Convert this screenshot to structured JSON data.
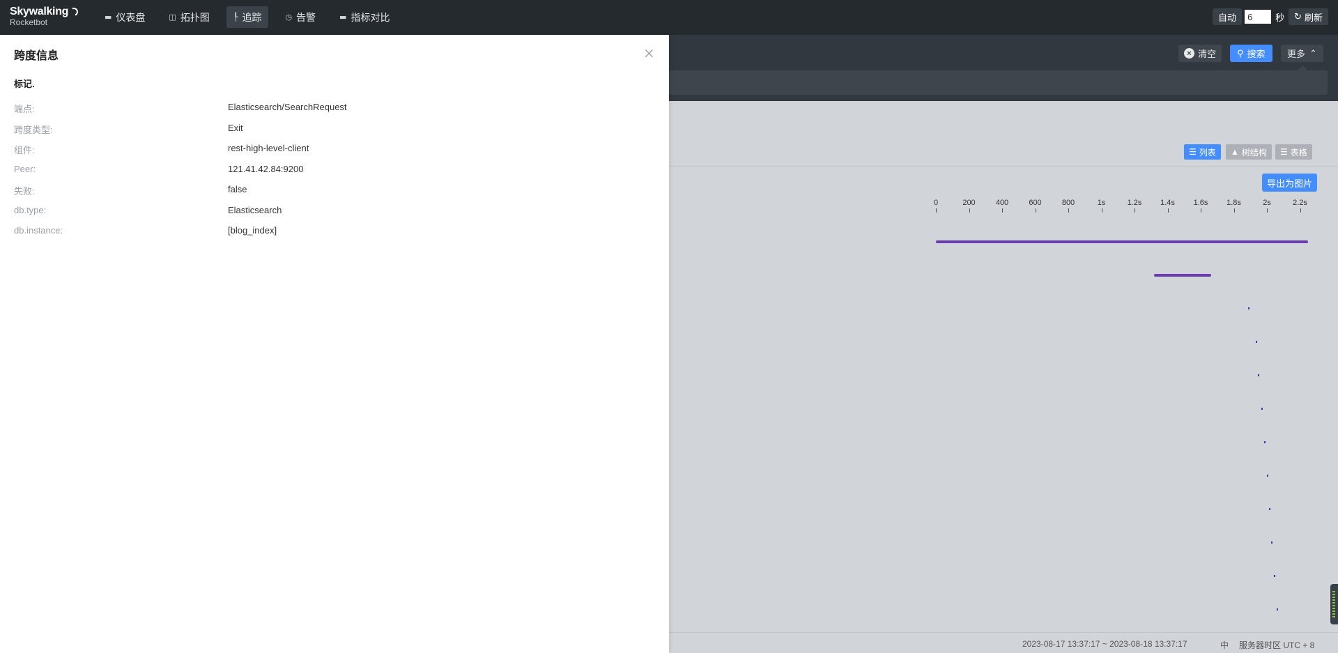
{
  "app": {
    "brand": "Skywalking",
    "subtitle": "Rocketbot"
  },
  "nav": {
    "items": [
      {
        "label": "仪表盘",
        "icon": "chart-icon"
      },
      {
        "label": "拓扑图",
        "icon": "topology-icon"
      },
      {
        "label": "追踪",
        "icon": "trace-icon",
        "active": true
      },
      {
        "label": "告警",
        "icon": "alarm-icon"
      },
      {
        "label": "指标对比",
        "icon": "compare-icon"
      }
    ]
  },
  "topright": {
    "auto_label": "自动",
    "interval_value": "6",
    "interval_unit": "秒",
    "refresh_label": "刷新"
  },
  "search": {
    "clear_label": "清空",
    "search_label": "搜索",
    "more_label": "更多"
  },
  "trace": {
    "view_list": "列表",
    "view_tree": "树结构",
    "view_table": "表格",
    "export_label": "导出为图片",
    "axis_ticks": [
      "0",
      "200",
      "400",
      "600",
      "800",
      "1s",
      "1.2s",
      "1.4s",
      "1.6s",
      "1.8s",
      "2s",
      "2.2s"
    ],
    "bar_color": "#6b3cb0"
  },
  "status": {
    "time_range": "2023-08-17 13:37:17 ~ 2023-08-18 13:37:17",
    "lang": "中",
    "timezone": "服务器时区 UTC + 8"
  },
  "drawer": {
    "title": "跨度信息",
    "close_icon": "close-icon",
    "section": "标记.",
    "tags": [
      {
        "key": "端点:",
        "value": "Elasticsearch/SearchRequest"
      },
      {
        "key": "跨度类型:",
        "value": "Exit"
      },
      {
        "key": "组件:",
        "value": "rest-high-level-client"
      },
      {
        "key": "Peer:",
        "value": "121.41.42.84:9200"
      },
      {
        "key": "失败:",
        "value": "false"
      },
      {
        "key": "db.type:",
        "value": "Elasticsearch"
      },
      {
        "key": "db.instance:",
        "value": "[blog_index]"
      }
    ]
  }
}
